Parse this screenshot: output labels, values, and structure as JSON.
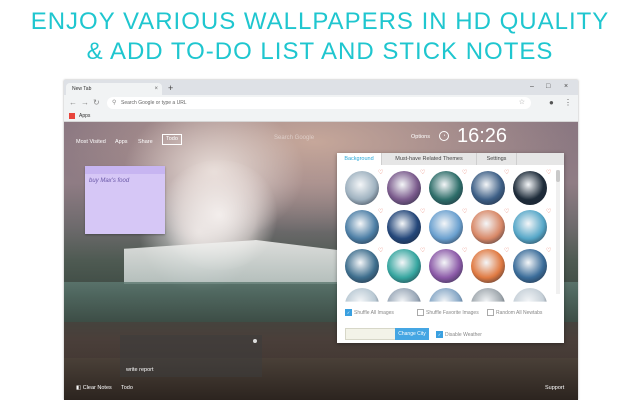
{
  "headline": {
    "line1": "ENJOY VARIOUS WALLPAPERS IN HD QUALITY",
    "line2": "& ADD TO-DO LIST AND STICK NOTES"
  },
  "browser": {
    "tab_title": "New Tab",
    "tab_close": "×",
    "new_tab": "+",
    "window_controls": {
      "minimize": "–",
      "maximize": "□",
      "close": "×"
    },
    "nav": {
      "back": "←",
      "forward": "→",
      "reload": "↻"
    },
    "omnibox_placeholder": "Search Google or type a URL",
    "bookmarks_apps": "Apps"
  },
  "newtab": {
    "nav": {
      "most_visited": "Most Visited",
      "apps": "Apps",
      "share": "Share",
      "todo": "Todo"
    },
    "search_hint": "Search Google",
    "options_label": "Options",
    "clock": "16:26",
    "sticky_note": "buy Max's food",
    "report_label": "write report",
    "bottom_left": {
      "clear_notes": "Clear Notes",
      "todo": "Todo"
    },
    "support": "Support"
  },
  "panel": {
    "tabs": [
      "Background",
      "Must-have Related Themes",
      "Settings"
    ],
    "active_tab": "Background",
    "checkboxes": [
      {
        "label": "Shuffle All Images",
        "checked": true
      },
      {
        "label": "Shuffle Favorite Images",
        "checked": false
      },
      {
        "label": "Random All Newtabs",
        "checked": false
      }
    ],
    "change_city": "Change City",
    "disable_weather": {
      "label": "Disable Weather",
      "checked": true
    },
    "thumbnails": [
      {
        "name": "frozen-falls",
        "color": "#9fb2c0"
      },
      {
        "name": "purple-sky-falls",
        "color": "#7a5a8c"
      },
      {
        "name": "teal-cascade",
        "color": "#2e6e6a"
      },
      {
        "name": "night-falls",
        "color": "#3d5f86"
      },
      {
        "name": "dark-falls",
        "color": "#1e2c3a"
      },
      {
        "name": "blue-mist",
        "color": "#4d7fa6"
      },
      {
        "name": "deep-blue-falls",
        "color": "#24477a"
      },
      {
        "name": "ice-blue-falls",
        "color": "#6aa0cf"
      },
      {
        "name": "sunset-falls",
        "color": "#d88867"
      },
      {
        "name": "aqua-falls",
        "color": "#56a7c8"
      },
      {
        "name": "river-falls",
        "color": "#3f6f8e"
      },
      {
        "name": "aurora-falls",
        "color": "#36a6a0"
      },
      {
        "name": "pink-night-falls",
        "color": "#8c5aa8"
      },
      {
        "name": "lake-sunset",
        "color": "#e07a42"
      },
      {
        "name": "twilight-falls",
        "color": "#3b6d9a"
      },
      {
        "name": "pale-sky",
        "color": "#b9c9d4"
      },
      {
        "name": "cloud-falls",
        "color": "#9aa8b8"
      },
      {
        "name": "soft-blue",
        "color": "#86a7c6"
      },
      {
        "name": "grey-falls",
        "color": "#a0a8ae"
      },
      {
        "name": "mist-white",
        "color": "#c6d0d8"
      }
    ]
  }
}
